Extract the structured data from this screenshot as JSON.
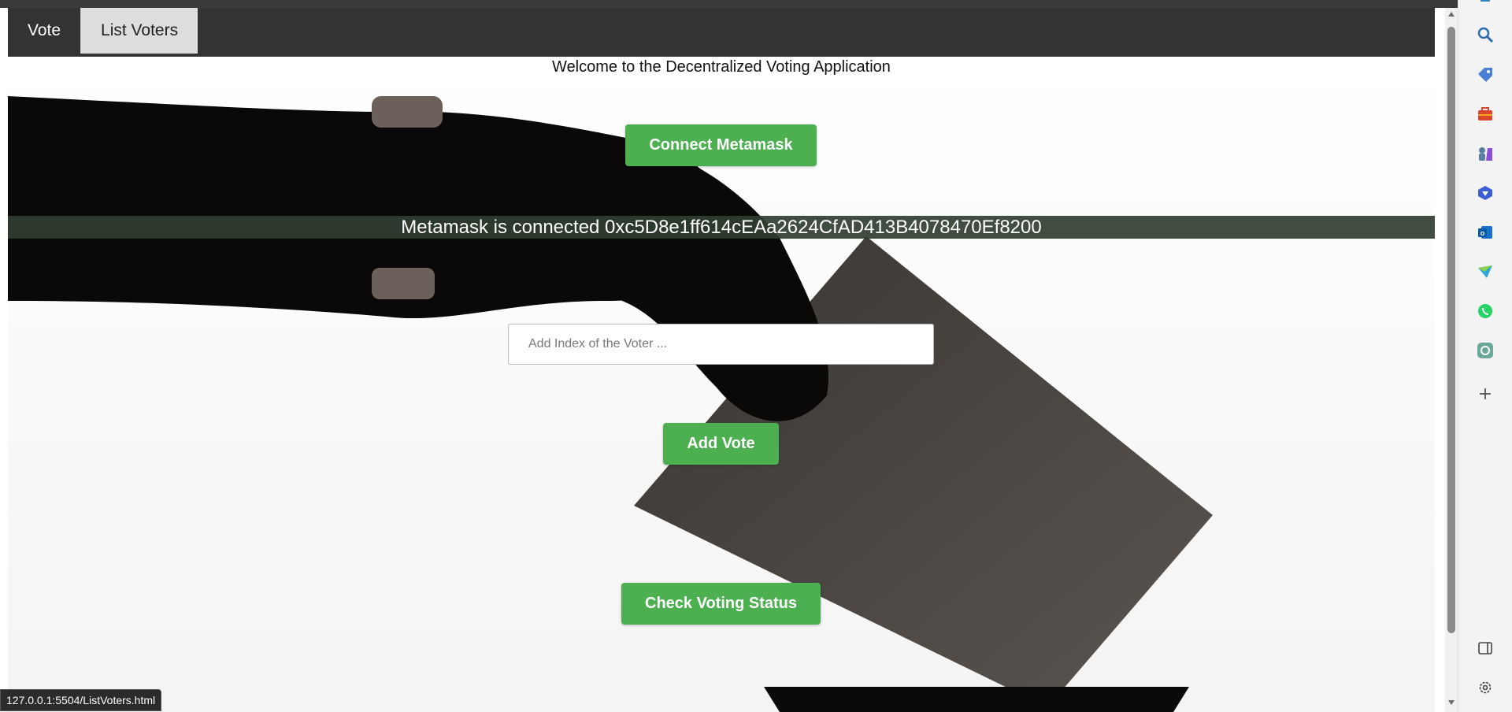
{
  "nav": {
    "tabs": [
      {
        "label": "Vote",
        "active": false
      },
      {
        "label": "List Voters",
        "active": true
      }
    ]
  },
  "main": {
    "welcome": "Welcome to the Decentralized Voting Application",
    "connect_button": "Connect Metamask",
    "connected_text": "Metamask is connected 0xc5D8e1ff614cEAa2624CfAD413B4078470Ef8200",
    "voter_input": {
      "placeholder": "Add Index of the Voter ...",
      "value": ""
    },
    "add_vote_button": "Add Vote",
    "check_status_button": "Check Voting Status"
  },
  "status_bar": {
    "url": "127.0.0.1:5504/ListVoters.html"
  },
  "sidebar": {
    "icons": [
      "notification-icon",
      "search-icon",
      "tag-icon",
      "briefcase-icon",
      "games-icon",
      "copilot-icon",
      "outlook-icon",
      "send-icon",
      "whatsapp-icon",
      "chatgpt-icon",
      "add-icon",
      "sidebar-toggle-icon",
      "settings-icon"
    ]
  },
  "colors": {
    "navbar": "#333333",
    "active_tab": "#dddddd",
    "button": "#4caf50",
    "connected_bar": "#323e32"
  }
}
